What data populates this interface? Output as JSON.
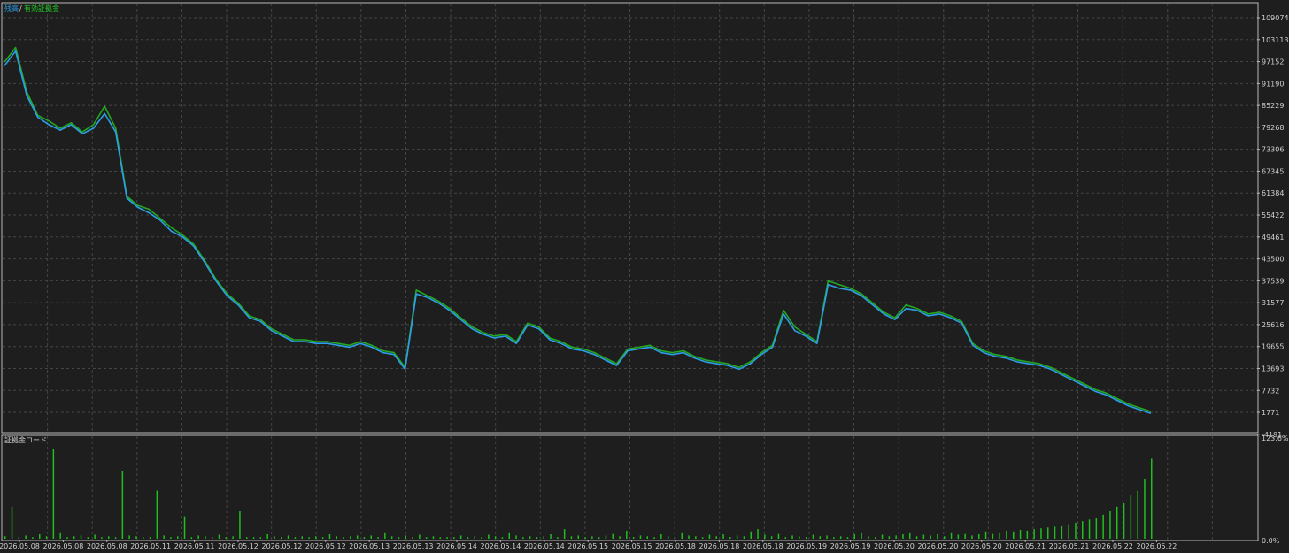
{
  "legend": {
    "balance": "残高",
    "separator": "/",
    "equity": "有効証拠金"
  },
  "subpanel_title": "証拠金ロード",
  "colors": {
    "background": "#1e1e1e",
    "border": "#b8b8b8",
    "grid": "#454545",
    "balance_line": "#2d9ee8",
    "equity_line": "#22a822",
    "load_bars": "#1fbf1f",
    "text": "#d0d0d0"
  },
  "chart_data": [
    {
      "type": "line",
      "y_ticks": [
        "109074",
        "103113",
        "97152",
        "91190",
        "85229",
        "79268",
        "73306",
        "67345",
        "61384",
        "55422",
        "49461",
        "43500",
        "37539",
        "31577",
        "25616",
        "19655",
        "13693",
        "7732",
        "1771",
        "-4191"
      ],
      "ylim": [
        -4191,
        112000
      ],
      "grid": true,
      "legend_position": "top-left",
      "series": [
        {
          "name": "残高",
          "color": "#2d9ee8",
          "values": [
            96000,
            100000,
            88000,
            82000,
            80000,
            78500,
            80000,
            77500,
            79000,
            83000,
            78000,
            60000,
            57500,
            56000,
            54000,
            51000,
            49500,
            47000,
            42500,
            37500,
            33500,
            31000,
            27500,
            26500,
            24000,
            22500,
            21000,
            21000,
            20500,
            20500,
            20000,
            19500,
            20500,
            19500,
            18000,
            17500,
            13500,
            34000,
            33000,
            31500,
            29500,
            27000,
            24500,
            23000,
            22000,
            22500,
            20500,
            25500,
            24500,
            21500,
            20500,
            19000,
            18500,
            17500,
            16000,
            14500,
            18500,
            19000,
            19500,
            18000,
            17500,
            18000,
            16500,
            15500,
            15000,
            14500,
            13500,
            15000,
            17500,
            19500,
            28500,
            24000,
            22500,
            20500,
            36500,
            35500,
            35000,
            33500,
            31000,
            28500,
            27000,
            30000,
            29500,
            28000,
            28500,
            27500,
            26000,
            20000,
            18000,
            17000,
            16500,
            15500,
            15000,
            14500,
            13500,
            12000,
            10500,
            9000,
            7500,
            6500,
            5000,
            3500,
            2500,
            1500
          ]
        },
        {
          "name": "有効証拠金",
          "color": "#22a822",
          "values": [
            97000,
            101000,
            89000,
            82500,
            81000,
            79000,
            80500,
            78000,
            80000,
            85000,
            79000,
            60500,
            58000,
            57000,
            54500,
            52000,
            50000,
            47500,
            43000,
            38000,
            34000,
            31500,
            28000,
            27000,
            24500,
            23000,
            21500,
            21500,
            21000,
            21000,
            20500,
            20000,
            21000,
            20000,
            18500,
            18000,
            14000,
            35000,
            33500,
            32000,
            30000,
            27500,
            25000,
            23500,
            22500,
            23000,
            21000,
            26000,
            25000,
            22000,
            21000,
            19500,
            19000,
            18000,
            16500,
            15000,
            19000,
            19500,
            20000,
            18500,
            18000,
            18500,
            17000,
            16000,
            15500,
            15000,
            14000,
            15500,
            18000,
            20000,
            29500,
            25000,
            23000,
            21000,
            37500,
            36500,
            35500,
            34000,
            31500,
            29000,
            27500,
            31000,
            30000,
            28500,
            29000,
            28000,
            26500,
            20500,
            18500,
            17500,
            17000,
            16000,
            15500,
            15000,
            14000,
            12500,
            11000,
            9500,
            8000,
            7000,
            5500,
            4000,
            3000,
            2000
          ]
        }
      ]
    },
    {
      "type": "bar",
      "y_ticks": [
        "123.6%",
        "0.0%"
      ],
      "ylim": [
        0,
        123.6
      ],
      "series": [
        {
          "name": "証拠金ロード",
          "color": "#1fbf1f",
          "values": [
            3,
            40,
            2,
            4,
            2,
            6,
            3,
            112,
            8,
            2,
            3,
            4,
            2,
            5,
            2,
            3,
            2,
            85,
            4,
            3,
            2,
            2,
            60,
            4,
            2,
            3,
            28,
            2,
            4,
            3,
            2,
            5,
            2,
            3,
            35,
            2,
            2,
            2,
            6,
            3,
            2,
            4,
            2,
            3,
            2,
            3,
            2,
            6,
            3,
            2,
            3,
            4,
            2,
            4,
            2,
            8,
            3,
            2,
            4,
            2,
            5,
            2,
            3,
            2,
            2,
            2,
            4,
            2,
            3,
            2,
            5,
            3,
            2,
            8,
            4,
            2,
            3,
            2,
            3,
            6,
            2,
            12,
            3,
            4,
            2,
            3,
            2,
            4,
            7,
            3,
            10,
            2,
            4,
            3,
            2,
            6,
            3,
            2,
            8,
            4,
            3,
            2,
            5,
            3,
            6,
            2,
            4,
            3,
            9,
            12,
            5,
            3,
            7,
            2,
            4,
            3,
            2,
            5,
            3,
            4,
            2,
            3,
            2,
            6,
            8,
            3,
            2,
            5,
            3,
            4,
            6,
            8,
            3,
            5,
            4,
            6,
            3,
            8,
            5,
            7,
            4,
            6,
            9,
            7,
            8,
            10,
            9,
            11,
            10,
            12,
            13,
            14,
            15,
            16,
            18,
            20,
            22,
            24,
            26,
            30,
            35,
            40,
            45,
            55,
            60,
            75,
            100
          ]
        }
      ]
    }
  ],
  "x_axis": {
    "labels": [
      "2026.05.08",
      "2026.05.08",
      "2026.05.08",
      "2026.05.11",
      "2026.05.11",
      "2026.05.12",
      "2026.05.12",
      "2026.05.12",
      "2026.05.13",
      "2026.05.13",
      "2026.05.14",
      "2026.05.14",
      "2026.05.14",
      "2026.05.15",
      "2026.05.15",
      "2026.05.18",
      "2026.05.18",
      "2026.05.18",
      "2026.05.19",
      "2026.05.19",
      "2026.05.20",
      "2026.05.20",
      "2026.05.20",
      "2026.05.21",
      "2026.05.21",
      "2026.05.22",
      "2026.05.22"
    ]
  }
}
